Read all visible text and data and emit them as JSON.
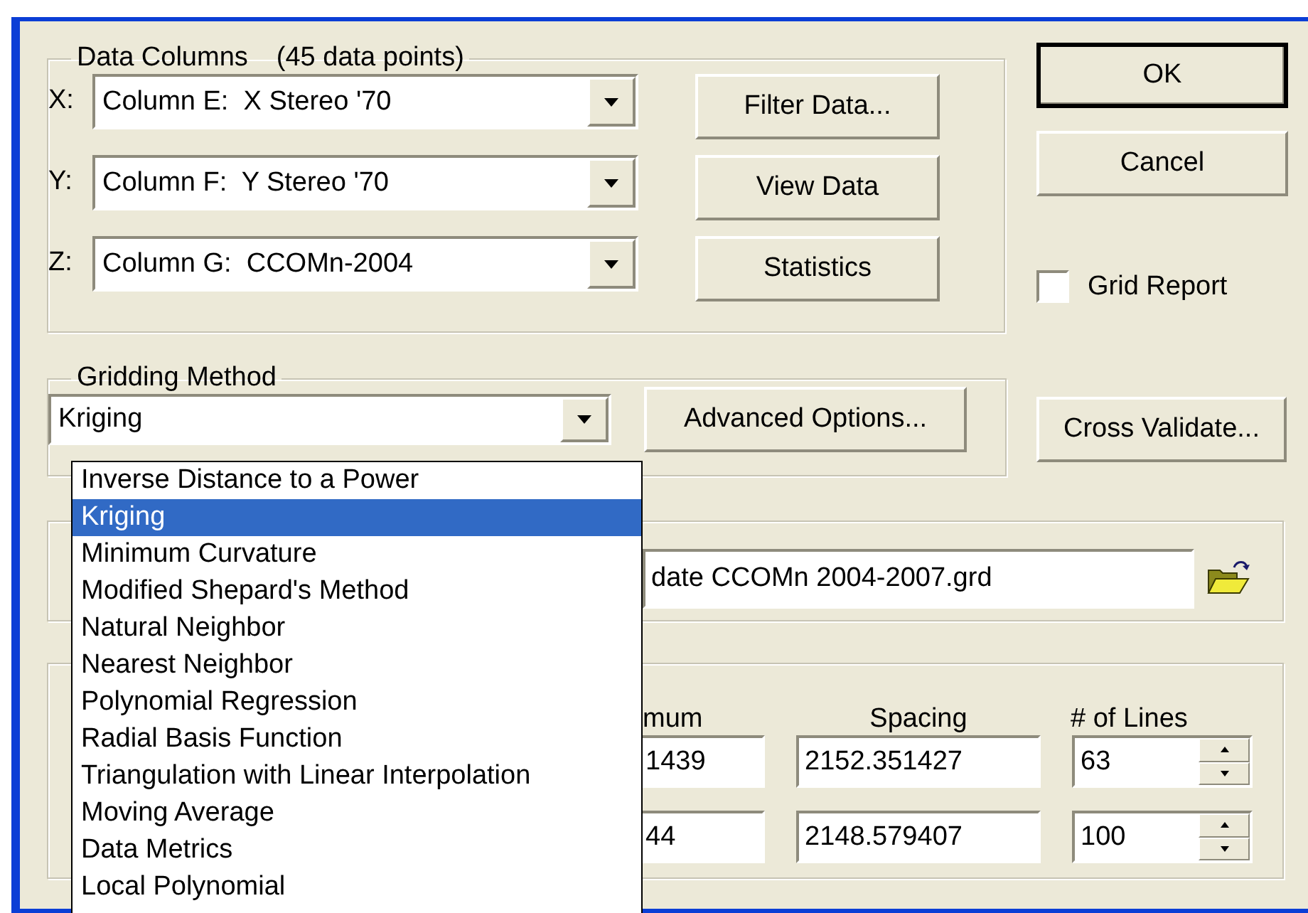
{
  "data_columns": {
    "title": "Data Columns",
    "count": "(45 data points)",
    "rows": [
      {
        "axis": "X:",
        "column": "Column E:  X Stereo '70",
        "button": "Filter Data..."
      },
      {
        "axis": "Y:",
        "column": "Column F:  Y Stereo '70",
        "button": "View Data"
      },
      {
        "axis": "Z:",
        "column": "Column G:  CCOMn-2004",
        "button": "Statistics"
      }
    ]
  },
  "dialog_buttons": {
    "ok": "OK",
    "cancel": "Cancel"
  },
  "grid_report": {
    "label": "Grid Report",
    "checked": false
  },
  "gridding_method": {
    "title": "Gridding Method",
    "value": "Kriging",
    "advanced_button": "Advanced Options...",
    "items": [
      {
        "label": "Inverse Distance to a Power",
        "selected": false
      },
      {
        "label": "Kriging",
        "selected": true
      },
      {
        "label": "Minimum Curvature",
        "selected": false
      },
      {
        "label": "Modified Shepard's Method",
        "selected": false
      },
      {
        "label": "Natural Neighbor",
        "selected": false
      },
      {
        "label": "Nearest Neighbor",
        "selected": false
      },
      {
        "label": "Polynomial Regression",
        "selected": false
      },
      {
        "label": "Radial Basis Function",
        "selected": false
      },
      {
        "label": "Triangulation with Linear Interpolation",
        "selected": false
      },
      {
        "label": "Moving Average",
        "selected": false
      },
      {
        "label": "Data Metrics",
        "selected": false
      },
      {
        "label": "Local Polynomial",
        "selected": false
      }
    ]
  },
  "cross_validate_button": "Cross Validate...",
  "output_file": {
    "value": "date CCOMn 2004-2007.grd"
  },
  "grid_geometry": {
    "columns": [
      "mum",
      "Spacing",
      "# of Lines"
    ],
    "rows": [
      {
        "minimum": "1439",
        "spacing": "2152.351427",
        "lines": "63"
      },
      {
        "minimum": "44",
        "spacing": "2148.579407",
        "lines": "100"
      }
    ]
  }
}
